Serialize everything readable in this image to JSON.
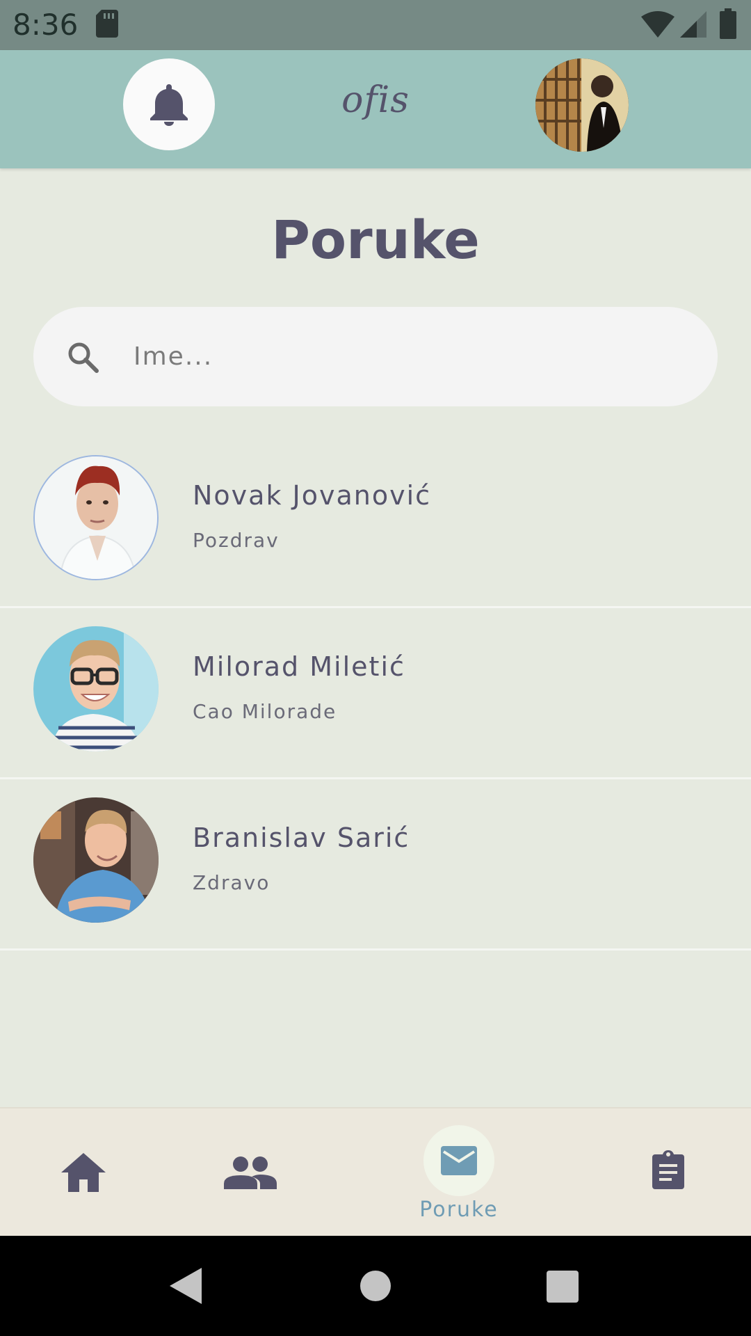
{
  "status_bar": {
    "time": "8:36",
    "icons": [
      "sd-card-icon",
      "wifi-icon",
      "signal-icon",
      "battery-icon"
    ]
  },
  "header": {
    "brand": "ofis",
    "icons": [
      "bell-icon",
      "profile-avatar"
    ]
  },
  "page": {
    "title": "Poruke"
  },
  "search": {
    "placeholder": "Ime...",
    "value": "",
    "icon": "search-icon"
  },
  "conversations": [
    {
      "name": "Novak Jovanović",
      "message": "Pozdrav"
    },
    {
      "name": "Milorad Miletić",
      "message": "Cao Milorade"
    },
    {
      "name": "Branislav Sarić",
      "message": "Zdravo"
    }
  ],
  "bottom_nav": {
    "items": [
      {
        "icon": "home-icon",
        "label": ""
      },
      {
        "icon": "people-icon",
        "label": ""
      },
      {
        "icon": "mail-icon",
        "label": "Poruke",
        "active": true
      },
      {
        "icon": "clipboard-icon",
        "label": ""
      }
    ]
  },
  "colors": {
    "status_bar": "#768a85",
    "header": "#9bc3bd",
    "background": "#e6eae0",
    "text": "#55536b",
    "accent": "#6f9cb4",
    "bottom_nav": "#ece8dd"
  }
}
